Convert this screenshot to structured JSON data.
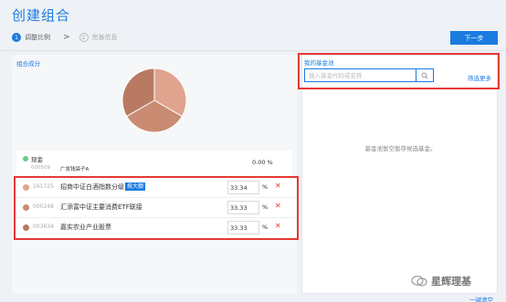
{
  "page": {
    "title": "创建组合"
  },
  "steps": [
    {
      "num": "1",
      "label": "调整比例"
    },
    {
      "num": "2",
      "label": "完善信息"
    }
  ],
  "chevron": ">",
  "next_button": "下一步",
  "composition": {
    "label": "组合成分"
  },
  "pie_chart": {
    "colors": [
      "#e0a48e",
      "#c98b72",
      "#b97a64"
    ],
    "values": [
      33.34,
      33.33,
      33.33
    ]
  },
  "cash": {
    "label": "现金",
    "code": "000509",
    "name": "广发钱袋子A",
    "pct": "0.00 %"
  },
  "holdings": [
    {
      "code": "161725",
      "name": "招商中证白酒指数分级",
      "tag": "按大额",
      "value": "33.34",
      "pct_sign": "%",
      "del": "✕",
      "color": "#e0a48e"
    },
    {
      "code": "000248",
      "name": "汇添富中证主要消费ETF联接",
      "tag": "",
      "value": "33.33",
      "pct_sign": "%",
      "del": "✕",
      "color": "#c98b72"
    },
    {
      "code": "003634",
      "name": "嘉实农业产业股票",
      "tag": "",
      "value": "33.33",
      "pct_sign": "%",
      "del": "✕",
      "color": "#b97a64"
    }
  ],
  "fund_pool": {
    "title": "我的基金池",
    "search_placeholder": "输入基金代码或名称",
    "filter_link": "筛选更多",
    "empty_message": "基金池暂空暂存候选基金。"
  },
  "clear_link": "一键清空",
  "watermark": {
    "text": "星辉理基"
  }
}
